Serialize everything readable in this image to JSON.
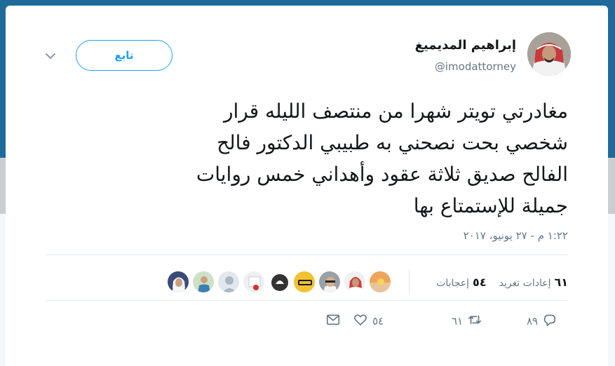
{
  "tweet": {
    "author": {
      "display_name": "إبراهيم المديميغ",
      "handle": "@imodattorney"
    },
    "follow_button_label": "تابع",
    "text": "مغادرتي تويتر شهرا من منتصف الليله قرار\nشخصي بحت نصحني به طبيبي الدكتور فالح\nالفالح صديق ثلاثة عقود وأهداني خمس روايات\nجميلة للإستمتاع بها",
    "timestamp": "١:٢٢ م - ٢٧ يونيو، ٢٠١٧",
    "stats": {
      "retweets_count": "٦١",
      "retweets_label": "إعادات تغريد",
      "likes_count": "٥٤",
      "likes_label": "إعجابات"
    },
    "actions": {
      "reply_count": "٨٩",
      "retweet_count": "٦١",
      "like_count": "٥٤"
    }
  },
  "colors": {
    "accent": "#1da1f2",
    "text_primary": "#14171a",
    "text_secondary": "#657786",
    "divider": "#e1e8ed"
  },
  "icons": [
    "caret-down-icon",
    "reply-icon",
    "retweet-icon",
    "heart-icon",
    "envelope-icon"
  ]
}
